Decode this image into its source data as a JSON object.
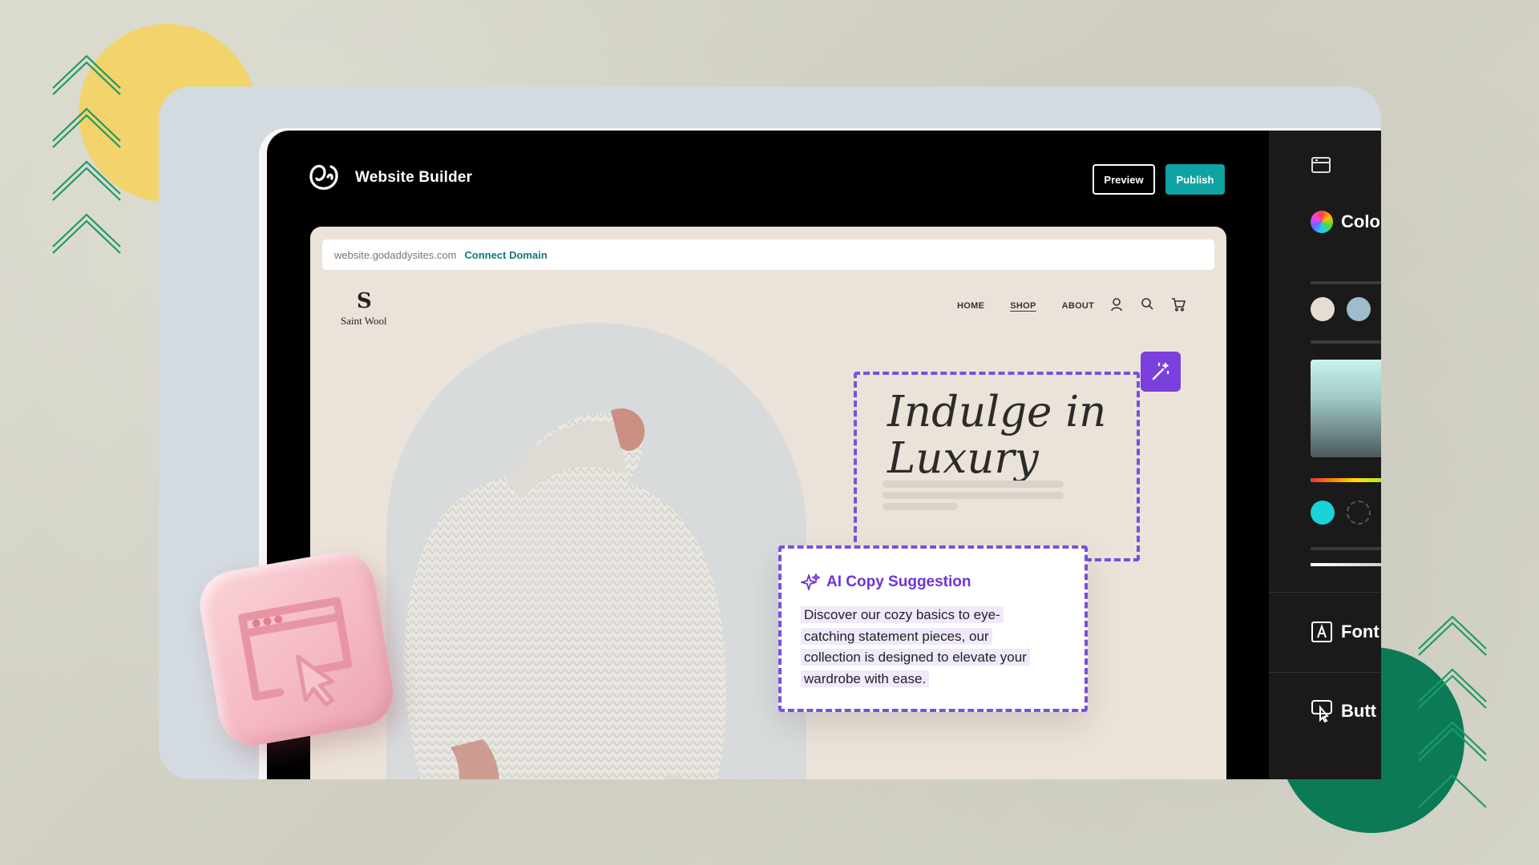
{
  "app": {
    "title": "Website Builder",
    "preview_label": "Preview",
    "publish_label": "Publish",
    "accent_color": "#0fa3a4"
  },
  "url_bar": {
    "url": "website.godaddysites.com",
    "connect_label": "Connect Domain"
  },
  "site": {
    "brand_mark": "S",
    "brand_name": "Saint Wool",
    "nav": [
      "HOME",
      "SHOP",
      "ABOUT"
    ],
    "active_nav": "SHOP",
    "heading": "Indulge in Luxury"
  },
  "ai_suggestion": {
    "title": "AI Copy Suggestion",
    "lines": [
      "Discover our cozy basics to eye-",
      "catching statement pieces, our",
      "collection is designed to elevate your",
      "wardrobe with ease."
    ],
    "accent_color": "#7a4fe0"
  },
  "right_panel": {
    "colors_label": "Colo",
    "fonts_label": "Font",
    "buttons_label": "Butt",
    "swatches": [
      "#e6dccf",
      "#9fbccc",
      "#19d3d8"
    ]
  },
  "icons": [
    "godaddy-logo-icon",
    "layout-icon",
    "color-wheel-icon",
    "user-icon",
    "search-icon",
    "cart-icon",
    "magic-wand-icon",
    "sparkle-icon",
    "font-icon",
    "button-icon"
  ]
}
